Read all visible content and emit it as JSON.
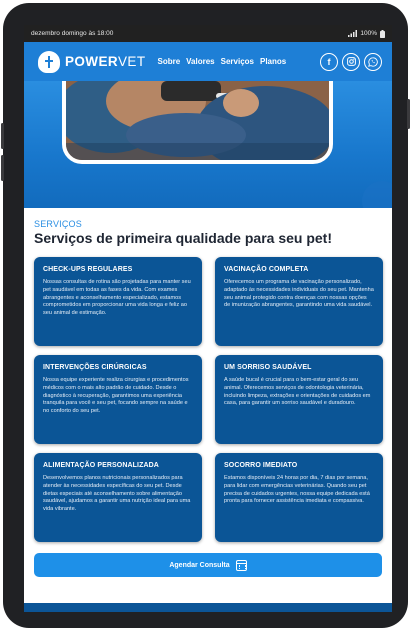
{
  "status_bar": {
    "datetime": "dezembro domingo às 18:00",
    "battery": "100%"
  },
  "header": {
    "brand_part1": "POWER",
    "brand_part2": "VET",
    "nav": [
      "Sobre",
      "Valores",
      "Serviços",
      "Planos"
    ],
    "socials": [
      "facebook-icon",
      "instagram-icon",
      "whatsapp-icon"
    ]
  },
  "services": {
    "kicker": "SERVIÇOS",
    "title": "Serviços de primeira qualidade para seu pet!",
    "cards": [
      {
        "title": "CHECK-UPS REGULARES",
        "text": "Nossas consultas de rotina são projetadas para manter seu pet saudável em todas as fases da vida. Com exames abrangentes e aconselhamento especializado, estamos comprometidos em proporcionar uma vida longa e feliz ao seu animal de estimação."
      },
      {
        "title": "VACINAÇÃO COMPLETA",
        "text": "Oferecemos um programa de vacinação personalizado, adaptado às necessidades individuais do seu pet. Mantenha seu animal protegido contra doenças com nossas opções de imunização abrangentes, garantindo uma vida saudável."
      },
      {
        "title": "INTERVENÇÕES CIRÚRGICAS",
        "text": "Nossa equipe experiente realiza cirurgias e procedimentos médicos com o mais alto padrão de cuidado. Desde o diagnóstico à recuperação, garantimos uma experiência tranquila para você e seu pet, focando sempre na saúde e no conforto do seu pet."
      },
      {
        "title": "UM SORRISO SAUDÁVEL",
        "text": "A saúde bucal é crucial para o bem-estar geral do seu animal. Oferecemos serviços de odontologia veterinária, incluindo limpeza, extrações e orientações de cuidados em casa, para garantir um sorriso saudável e duradouro."
      },
      {
        "title": "ALIMENTAÇÃO PERSONALIZADA",
        "text": "Desenvolvemos planos nutricionais personalizados para atender às necessidades específicas do seu pet. Desde dietas especiais até aconselhamento sobre alimentação saudável, ajudamos a garantir uma nutrição ideal para uma vida vibrante."
      },
      {
        "title": "SOCORRO IMEDIATO",
        "text": "Estamos disponíveis 24 horas por dia, 7 dias por semana, para lidar com emergências veterinárias. Quando seu pet precisa de cuidados urgentes, nossa equipe dedicada está pronta para fornecer assistência imediata e compassiva."
      }
    ],
    "cta_label": "Agendar Consulta"
  },
  "colors": {
    "brand_blue": "#1e7fd6",
    "card_blue": "#0b5596",
    "cta_blue": "#1e90e8",
    "kicker_blue": "#2b8fe3"
  }
}
